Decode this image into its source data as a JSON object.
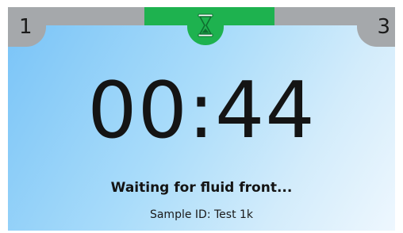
{
  "steps": {
    "left_label": "1",
    "right_label": "3",
    "active_icon": "hourglass-icon"
  },
  "timer": {
    "value": "00:44"
  },
  "status": {
    "message": "Waiting for fluid front..."
  },
  "sample": {
    "label": "Sample ID: Test 1k"
  },
  "colors": {
    "active": "#1eb24f",
    "inactive": "#a5a8ab",
    "background_start": "#78c3f7",
    "background_end": "#eef7fe"
  }
}
